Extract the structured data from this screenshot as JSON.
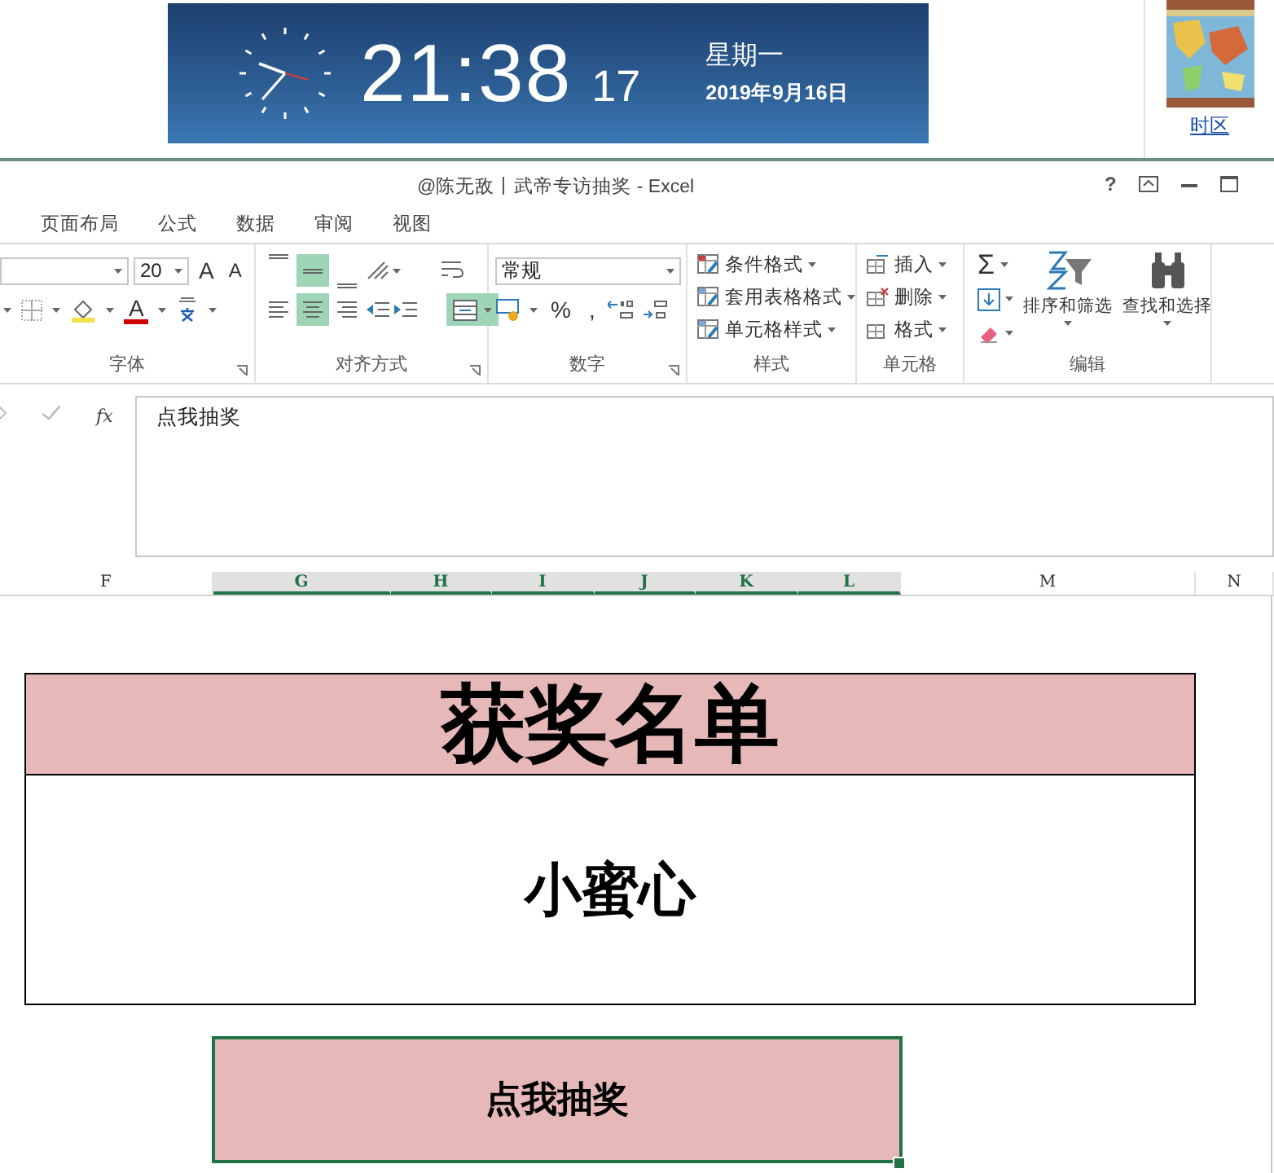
{
  "clock": {
    "time": "21:38",
    "seconds": "17",
    "weekday": "星期一",
    "date": "2019年9月16日"
  },
  "side_panel": {
    "link": "时区"
  },
  "window": {
    "title": "@陈无敌丨武帝专访抽奖 - Excel",
    "help": "?"
  },
  "tabs": [
    {
      "label": "页面布局",
      "selected": false
    },
    {
      "label": "公式",
      "selected": false
    },
    {
      "label": "数据",
      "selected": false
    },
    {
      "label": "审阅",
      "selected": false
    },
    {
      "label": "视图",
      "selected": false
    }
  ],
  "ribbon": {
    "font": {
      "size": "20",
      "grow": "A",
      "shrink": "A",
      "color_letter": "A",
      "label": "字体"
    },
    "alignment": {
      "vertical": [
        {
          "selected": false
        },
        {
          "selected": true
        },
        {
          "selected": false
        }
      ],
      "horizontal": [
        {
          "selected": false
        },
        {
          "selected": true
        },
        {
          "selected": false
        }
      ],
      "merge": {
        "selected": true
      },
      "label": "对齐方式"
    },
    "number": {
      "format": "常规",
      "percent": "%",
      "comma": ",",
      "label": "数字"
    },
    "styles": {
      "items": [
        "条件格式",
        "套用表格格式",
        "单元格样式"
      ],
      "label": "样式"
    },
    "cells": {
      "items": [
        "插入",
        "删除",
        "格式"
      ],
      "label": "单元格"
    },
    "editing": {
      "sum": "Σ",
      "sort": "排序和筛选",
      "find": "查找和选择",
      "label": "编辑"
    }
  },
  "formula_bar": {
    "fx": "fx",
    "value": "点我抽奖"
  },
  "columns": [
    {
      "label": "F",
      "selected": false
    },
    {
      "label": "G",
      "selected": true
    },
    {
      "label": "H",
      "selected": true
    },
    {
      "label": "I",
      "selected": true
    },
    {
      "label": "J",
      "selected": true
    },
    {
      "label": "K",
      "selected": true
    },
    {
      "label": "L",
      "selected": true
    },
    {
      "label": "M",
      "selected": false
    },
    {
      "label": "N",
      "selected": false
    }
  ],
  "sheet": {
    "title": "获奖名单",
    "winner": "小蜜心",
    "button": "点我抽奖"
  }
}
